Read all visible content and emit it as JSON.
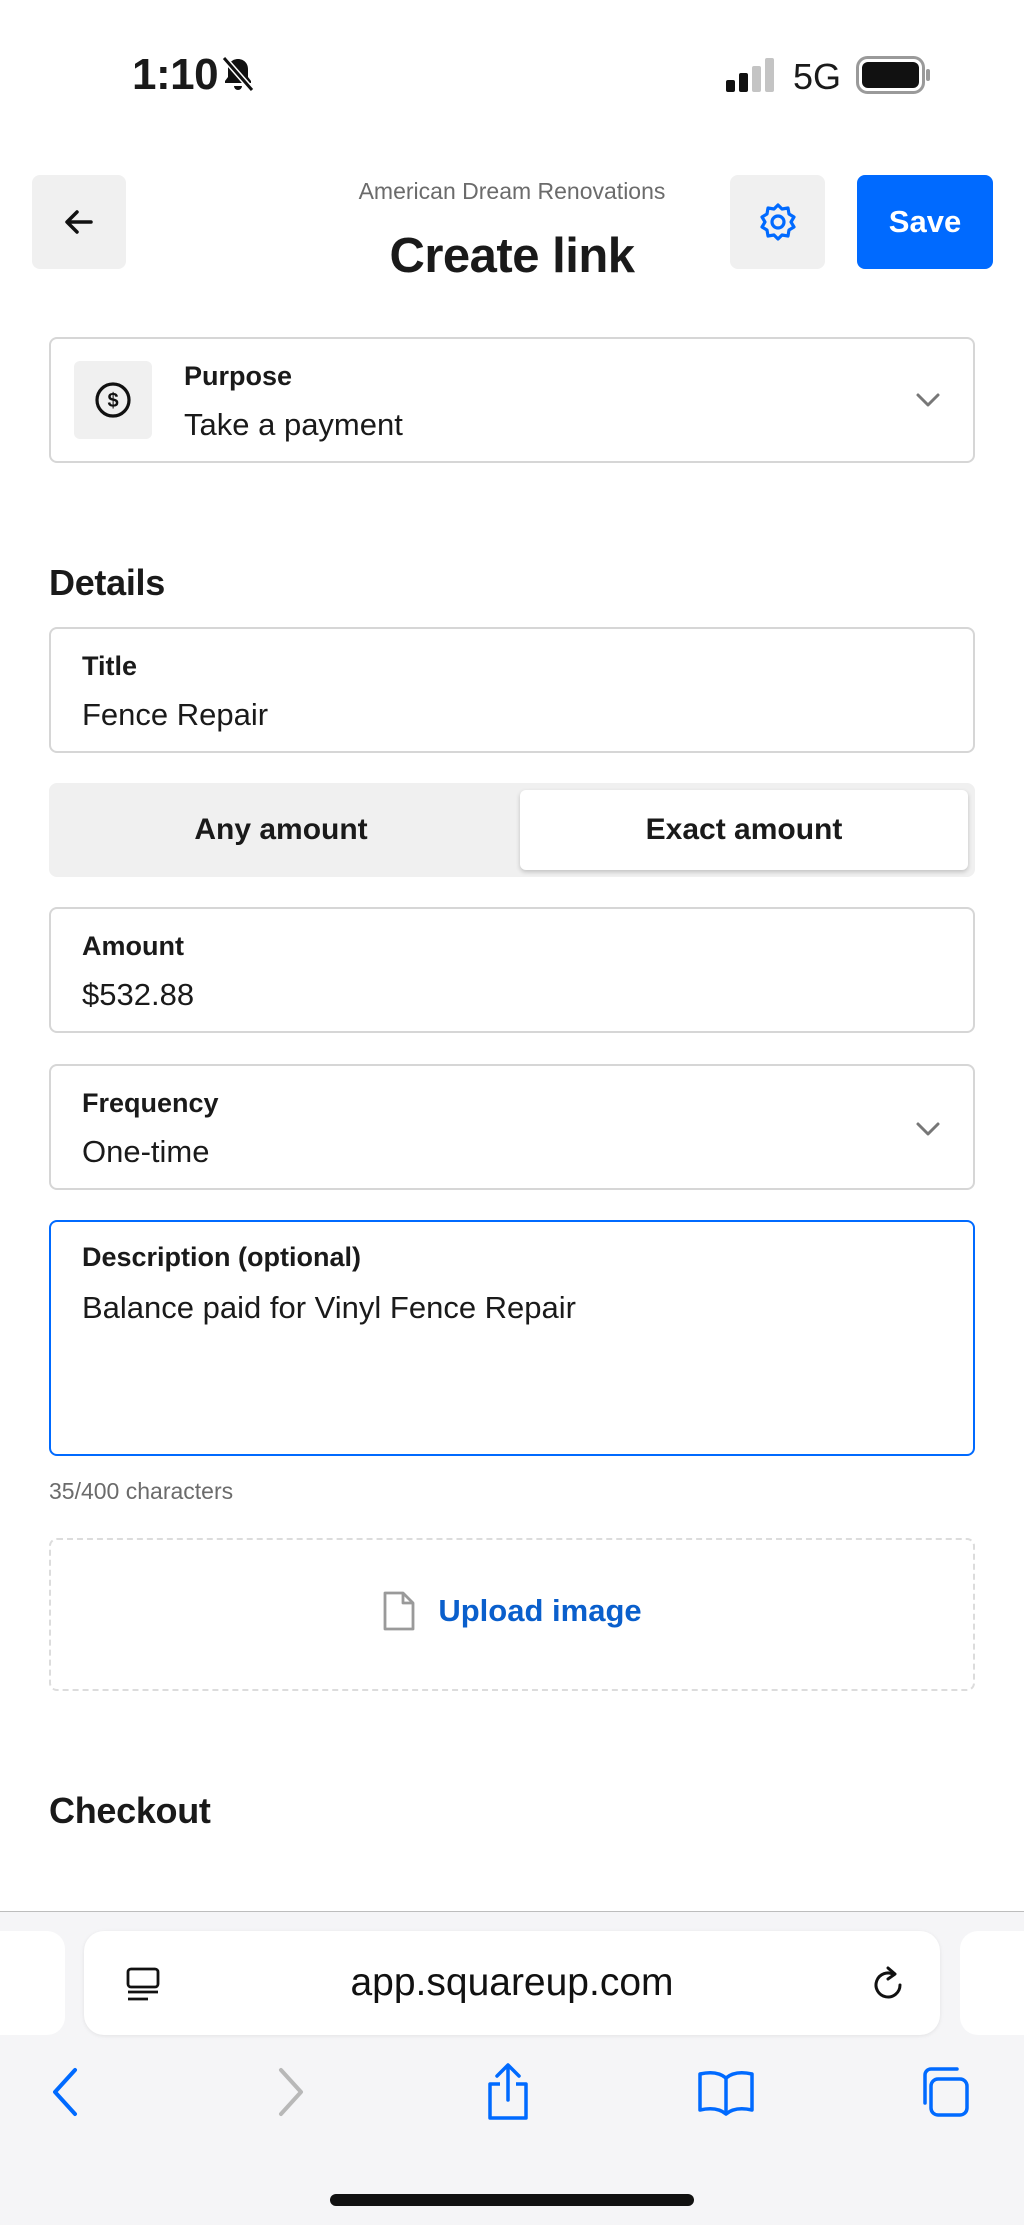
{
  "status_bar": {
    "time": "1:10",
    "network": "5G",
    "icons": [
      "bell-slash-icon",
      "signal-icon",
      "battery-icon"
    ]
  },
  "header": {
    "business_name": "American Dream Renovations",
    "title": "Create link",
    "back_icon": "arrow-left-icon",
    "settings_icon": "gear-icon",
    "save_label": "Save"
  },
  "purpose": {
    "label": "Purpose",
    "value": "Take a payment",
    "icon": "dollar-circle-icon"
  },
  "details": {
    "heading": "Details",
    "title_label": "Title",
    "title_value": "Fence Repair",
    "amount_type": {
      "options": [
        "Any amount",
        "Exact amount"
      ],
      "selected": "Exact amount"
    },
    "amount_label": "Amount",
    "amount_value": "$532.88",
    "frequency_label": "Frequency",
    "frequency_value": "One-time",
    "description_label": "Description (optional)",
    "description_value": "Balance paid for Vinyl Fence Repair",
    "char_count": "35/400 characters",
    "upload_label": "Upload image"
  },
  "checkout": {
    "heading": "Checkout"
  },
  "browser": {
    "url": "app.squareup.com",
    "toolbar_icons": [
      "back-icon",
      "forward-icon",
      "share-icon",
      "bookmarks-icon",
      "tabs-icon"
    ]
  },
  "colors": {
    "accent": "#006aff",
    "link": "#0a5fcc",
    "field_border": "#d6d6d6",
    "muted_bg": "#f0f0f0"
  }
}
